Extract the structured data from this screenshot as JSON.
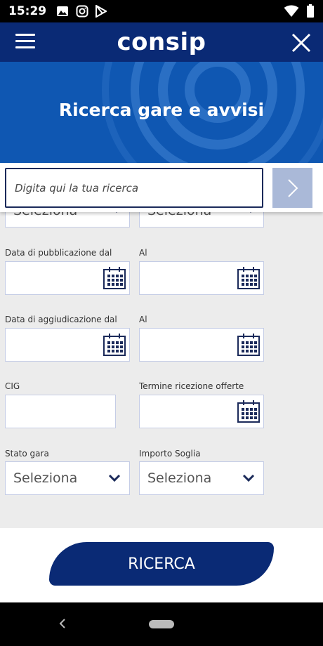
{
  "status_bar": {
    "time": "15:29",
    "left_icons": [
      "image-icon",
      "instagram-icon",
      "play-store-icon"
    ],
    "right_icons": [
      "wifi-icon",
      "battery-icon"
    ]
  },
  "header": {
    "logo": "consip",
    "menu_icon": "hamburger-icon",
    "close_icon": "close-icon"
  },
  "hero": {
    "title": "Ricerca gare e avvisi"
  },
  "search": {
    "placeholder": "Digita qui la tua ricerca",
    "value": "",
    "go_icon": "chevron-right-icon"
  },
  "form": {
    "partial_selects": [
      "Seleziona",
      "Seleziona"
    ],
    "pub_date_from_label": "Data di pubblicazione dal",
    "pub_date_to_label": "Al",
    "award_date_from_label": "Data di aggiudicazione dal",
    "award_date_to_label": "Al",
    "cig_label": "CIG",
    "offer_deadline_label": "Termine ricezione offerte",
    "stato_gara_label": "Stato gara",
    "stato_gara_value": "Seleziona",
    "importo_soglia_label": "Importo Soglia",
    "importo_soglia_value": "Seleziona"
  },
  "actions": {
    "search_button": "RICERCA"
  },
  "colors": {
    "navy": "#0a2a75",
    "hero_blue": "#0f57b2",
    "go_button": "#aab9d8",
    "field_border": "#c5cde6"
  }
}
